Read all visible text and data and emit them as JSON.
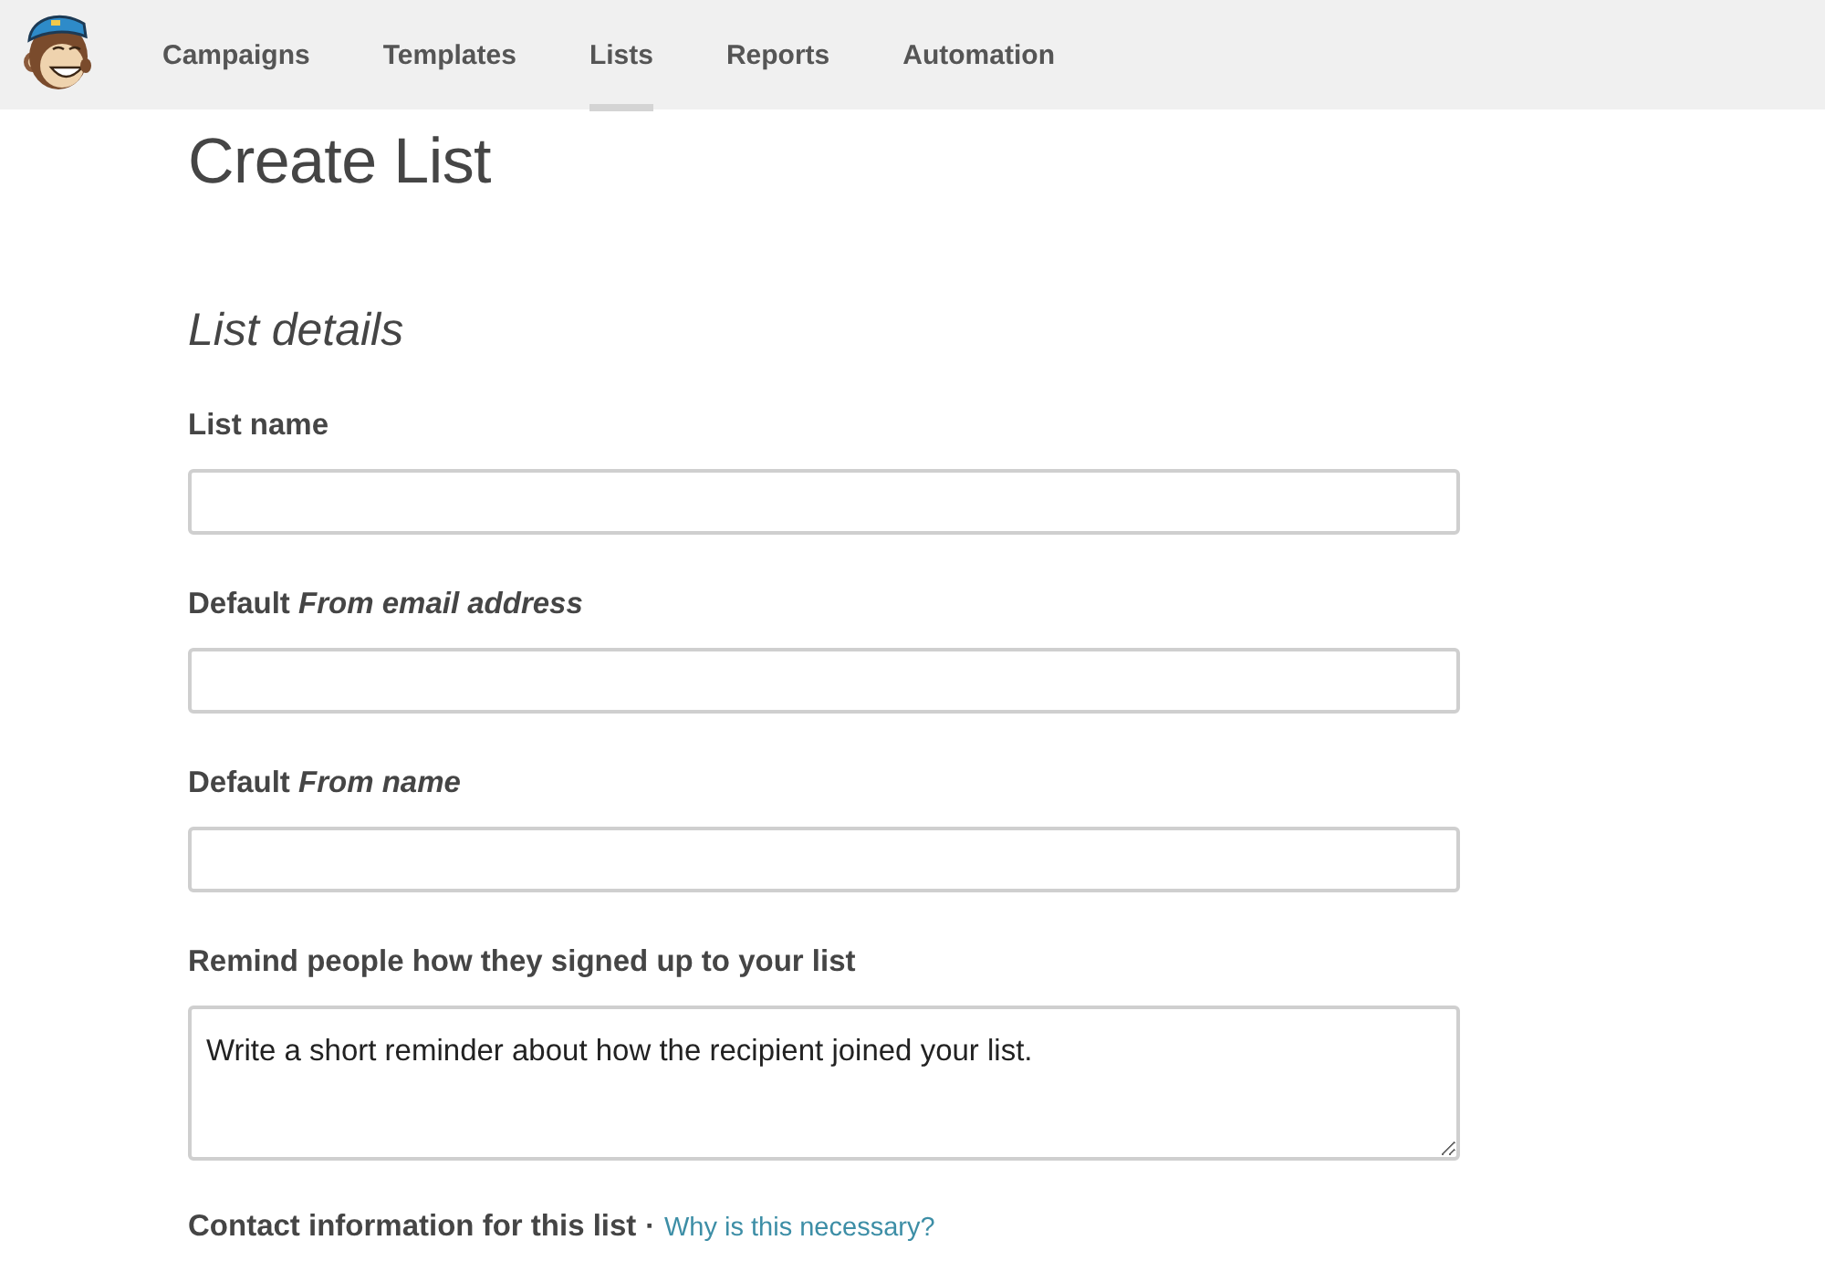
{
  "nav": {
    "items": [
      {
        "label": "Campaigns",
        "selected": false
      },
      {
        "label": "Templates",
        "selected": false
      },
      {
        "label": "Lists",
        "selected": true
      },
      {
        "label": "Reports",
        "selected": false
      },
      {
        "label": "Automation",
        "selected": false
      }
    ]
  },
  "page": {
    "title": "Create List",
    "section_title": "List details",
    "fields": [
      {
        "kind": "input",
        "label": "List name"
      },
      {
        "kind": "input",
        "label": "Default *From email address*"
      },
      {
        "kind": "input",
        "label": "Default *From name*"
      },
      {
        "kind": "textarea",
        "label": "Remind people how they signed up to your list",
        "value": "Write a short reminder about how the recipient joined your list."
      }
    ],
    "contact": {
      "label": "Contact information for this list",
      "separator": "·",
      "link": "Why is this necessary?"
    }
  }
}
